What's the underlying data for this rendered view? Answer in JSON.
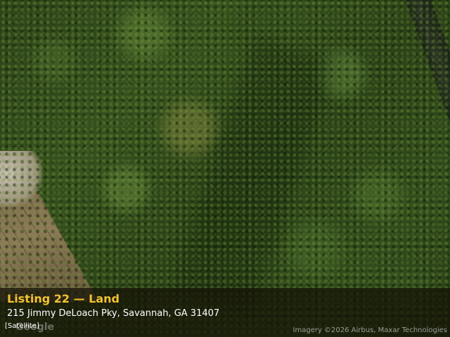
{
  "listing": {
    "title": "Listing 22 — Land",
    "address": "215 Jimmy DeLoach Pky, Savannah, GA 31407"
  },
  "map": {
    "type_label": "[Satellite]",
    "logo_text": "Google",
    "attribution": "Imagery ©2026 Airbus, Maxar Technologies",
    "accent_color": "#f2c230"
  }
}
